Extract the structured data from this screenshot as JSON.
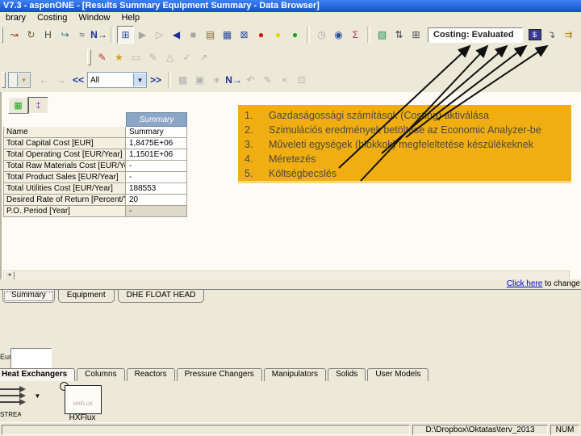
{
  "window": {
    "title": "V7.3 - aspenONE - [Results Summary Equipment Summary - Data Browser]"
  },
  "menu": {
    "items": [
      "brary",
      "Costing",
      "Window",
      "Help"
    ]
  },
  "colors": {
    "titlebar_a": "#3c81f3",
    "titlebar_b": "#1450c8",
    "annotation_bg": "#F0AE12",
    "annotation_text": "#4a4a42",
    "header_blue": "#8CA6C6"
  },
  "toolbar_main": {
    "icons": [
      {
        "name": "reconnect-tool-icon",
        "glyph": "↝",
        "color": "#b03232"
      },
      {
        "name": "rotate-icon",
        "glyph": "↻",
        "color": "#7a5230"
      },
      {
        "name": "heat-label-icon",
        "glyph": "H",
        "color": "#444444"
      },
      {
        "name": "reroute-icon",
        "glyph": "↪",
        "color": "#2e7d7d"
      },
      {
        "name": "annotation-tool-icon",
        "glyph": "≈",
        "color": "#555566"
      },
      {
        "name": "next-input-icon",
        "glyph": "N→",
        "color": "#1c2f9e",
        "bold": true
      },
      {
        "sep": true
      },
      {
        "name": "data-browser-icon",
        "glyph": "⊞",
        "color": "#2a4ba0",
        "pressed": true
      },
      {
        "name": "run-icon",
        "glyph": "▶",
        "color": "#9a9a9a",
        "disabled": true
      },
      {
        "name": "step-icon",
        "glyph": "▷",
        "color": "#9a9a9a",
        "disabled": true
      },
      {
        "name": "reinitialize-icon",
        "glyph": "◀",
        "color": "#1c2f9e"
      },
      {
        "name": "stop-icon",
        "glyph": "■",
        "color": "#9a9a9a",
        "disabled": true
      },
      {
        "name": "control-panel-icon",
        "glyph": "▤",
        "color": "#8a6d3b"
      },
      {
        "name": "check-results-icon",
        "glyph": "▦",
        "color": "#2a4ba0"
      },
      {
        "name": "flowsheet-windows-icon",
        "glyph": "⊠",
        "color": "#2a4ba0"
      },
      {
        "name": "status-red-icon",
        "glyph": "●",
        "color": "#d01010"
      },
      {
        "name": "status-yellow-icon",
        "glyph": "●",
        "color": "#e6d400"
      },
      {
        "name": "status-green-icon",
        "glyph": "●",
        "color": "#18a818"
      },
      {
        "sep": true
      },
      {
        "name": "stopwatch-icon",
        "glyph": "◷",
        "color": "#9a9a9a",
        "disabled": true
      },
      {
        "name": "alarm-clock-icon",
        "glyph": "◉",
        "color": "#2a4ba0"
      },
      {
        "name": "equation-editor-icon",
        "glyph": "Σ",
        "color": "#b03060"
      },
      {
        "sep": true
      },
      {
        "name": "plot-icon",
        "glyph": "▧",
        "color": "#1a8a4a"
      },
      {
        "name": "sort-icon",
        "glyph": "⇅",
        "color": "#444455"
      },
      {
        "name": "table-icon",
        "glyph": "⊞",
        "color": "#444455"
      }
    ],
    "costing_status_label": "Costing: Evaluated",
    "costing_icons": [
      {
        "name": "costing-activate-icon",
        "glyph": "$",
        "color": "#ffffff",
        "bg": "#39399a"
      },
      {
        "name": "load-sim-results-icon",
        "glyph": "↴",
        "color": "#555566"
      },
      {
        "name": "map-equipment-icon",
        "glyph": "⇉",
        "color": "#b8860b"
      },
      {
        "name": "size-equipment-icon",
        "glyph": "▩",
        "color": "#18a818"
      },
      {
        "name": "evaluate-costs-icon",
        "glyph": "$",
        "color": "#b03060",
        "bold": true
      },
      {
        "name": "cost-table-icon",
        "glyph": "▦",
        "color": "#18a818"
      },
      {
        "name": "cost-report-icon",
        "glyph": "▥",
        "color": "#2a4ba0"
      },
      {
        "name": "stream-costs-icon",
        "glyph": "s",
        "color": "#777777"
      }
    ]
  },
  "toolbar_draw": {
    "icons": [
      {
        "name": "pencil-icon",
        "glyph": "✎",
        "color": "#c03030"
      },
      {
        "name": "highlight-icon",
        "glyph": "★",
        "color": "#d4a017"
      },
      {
        "name": "eraser-icon",
        "glyph": "▭",
        "color": "#aaaaaa",
        "disabled": true
      },
      {
        "name": "note-icon",
        "glyph": "✎",
        "color": "#aaaaaa",
        "disabled": true
      },
      {
        "name": "ink-icon",
        "glyph": "△",
        "color": "#aaaaaa",
        "disabled": true
      },
      {
        "name": "approve-icon",
        "glyph": "✓",
        "color": "#aaaaaa",
        "disabled": true
      },
      {
        "name": "trend-icon",
        "glyph": "↗",
        "color": "#aaaaaa",
        "disabled": true
      }
    ]
  },
  "nav": {
    "icons_pre": [
      {
        "name": "nav-back-icon",
        "glyph": "←",
        "color": "#9a9a9a",
        "disabled": true
      },
      {
        "name": "nav-forward-icon",
        "glyph": "→",
        "color": "#9a9a9a",
        "disabled": true
      }
    ],
    "prev_label": "<<",
    "next_label": ">>",
    "filter_value": "All",
    "icons_post": [
      {
        "name": "compare-icon",
        "glyph": "▩",
        "color": "#aaaaaa",
        "disabled": true
      },
      {
        "name": "camera-icon",
        "glyph": "▣",
        "color": "#aaaaaa",
        "disabled": true
      },
      {
        "name": "gear-icon",
        "glyph": "∗",
        "color": "#aaaaaa",
        "disabled": true
      },
      {
        "name": "next-input-icon",
        "glyph": "N→",
        "color": "#1c2f9e",
        "bold": true
      },
      {
        "name": "undo-icon",
        "glyph": "↶",
        "color": "#aaaaaa",
        "disabled": true
      },
      {
        "name": "modify-icon",
        "glyph": "✎",
        "color": "#aaaaaa",
        "disabled": true
      },
      {
        "name": "delete-icon",
        "glyph": "×",
        "color": "#aaaaaa",
        "disabled": true
      },
      {
        "name": "restore-icon",
        "glyph": "⊡",
        "color": "#aaaaaa",
        "disabled": true
      }
    ]
  },
  "databrowser": {
    "view_icons": [
      {
        "name": "cost-summary-view-icon",
        "glyph": "▦",
        "color": "#18a818"
      },
      {
        "name": "utilities-view-icon",
        "glyph": "‡",
        "color": "#8a2be2"
      }
    ],
    "table": {
      "header": "Summary",
      "rows": [
        {
          "label": "Name",
          "value": "Summary"
        },
        {
          "label": "Total Capital Cost [EUR]",
          "value": "1,8475E+06"
        },
        {
          "label": "Total Operating Cost [EUR/Year]",
          "value": "1,1501E+06"
        },
        {
          "label": "Total Raw Materials Cost [EUR/Year]",
          "value": "-"
        },
        {
          "label": "Total Product Sales [EUR/Year]",
          "value": "-"
        },
        {
          "label": "Total Utilities Cost [EUR/Year]",
          "value": "188553"
        },
        {
          "label": "Desired Rate of Return [Percent/Year]",
          "value": "20"
        },
        {
          "label": "P.O. Period [Year]",
          "value": "-",
          "muted": true
        }
      ]
    },
    "link": {
      "text": "Click here",
      "suffix": " to change"
    },
    "tabs": [
      {
        "label": "Summary",
        "active": true
      },
      {
        "label": "Equipment"
      },
      {
        "label": "DHE FLOAT HEAD"
      }
    ]
  },
  "annotation": {
    "items": [
      {
        "num": "1.",
        "text": "Gazdaságossági számítások (Costing) aktiválása"
      },
      {
        "num": "2.",
        "text": "Szimulációs eredmények betöltése az Economic Analyzer-be"
      },
      {
        "num": "3.",
        "text": "Műveleti egységek (blokkok) megfeleltetése készülékeknek"
      },
      {
        "num": "4.",
        "text": "Méretezés"
      },
      {
        "num": "5.",
        "text": "Költségbecslés"
      }
    ]
  },
  "flowsheet": {
    "field_label": "Eur..."
  },
  "palette": {
    "tabs": [
      {
        "label": "Heat Exchangers",
        "active": true
      },
      {
        "label": "Columns"
      },
      {
        "label": "Reactors"
      },
      {
        "label": "Pressure Changers"
      },
      {
        "label": "Manipulators"
      },
      {
        "label": "Solids"
      },
      {
        "label": "User Models"
      }
    ],
    "streams_label": "STREAMS",
    "streams_drop_glyph": "▼",
    "model": {
      "label": "HXFlux",
      "icon_text": "HXFLUX"
    }
  },
  "statusbar": {
    "path": "D:\\Dropbox\\Oktatas\\terv_2013",
    "num": "NUM"
  }
}
